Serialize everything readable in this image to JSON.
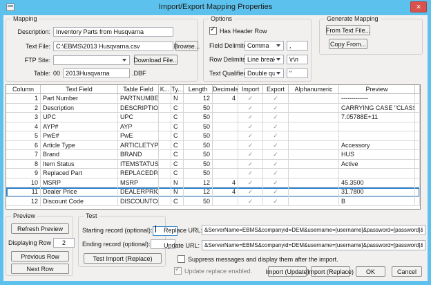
{
  "window": {
    "title": "Import/Export Mapping Properties",
    "close_glyph": "✕"
  },
  "icons": {
    "check": "✓"
  },
  "colors": {
    "titlebar": "#5cc1ec",
    "close_button": "#d9534c",
    "selection": "#3585cc",
    "checkmark": "#8f8f8f"
  },
  "mapping": {
    "group_label": "Mapping",
    "description_label": "Description:",
    "description_value": "Inventory Parts from Husqvarna",
    "text_file_label": "Text File:",
    "text_file_value": "C:\\EBMS\\2013 Husqvarna.csv",
    "browse_button": "Browse...",
    "ftp_site_label": "FTP Site:",
    "ftp_site_value": "",
    "download_file_button": "Download File...",
    "table_label": "Table:",
    "table_prefix": "00",
    "table_value": "2013Husqvarna",
    "table_suffix": ".DBF"
  },
  "options": {
    "group_label": "Options",
    "has_header_row_label": "Has Header Row",
    "has_header_row_checked": true,
    "field_delimiter_label": "Field Delimiter:",
    "field_delimiter_selected": "Comma",
    "field_delimiter_char": ",",
    "row_delimiter_label": "Row Delimiter:",
    "row_delimiter_selected": "Line break",
    "row_delimiter_char": "\\r\\n",
    "text_qualifier_label": "Text Qualifier:",
    "text_qualifier_selected": "Double quote",
    "text_qualifier_char": "\""
  },
  "generate_mapping": {
    "group_label": "Generate Mapping",
    "from_text_file_button": "From Text File...",
    "copy_from_button": "Copy From..."
  },
  "grid": {
    "columns": [
      "Column",
      "Text Field",
      "Table Field",
      "K...",
      "Ty...",
      "Length",
      "Decimals",
      "Import",
      "Export",
      "Alphanumeric",
      "Preview"
    ],
    "selected_row": 11,
    "rows": [
      {
        "column": "1",
        "text_field": "Part Number",
        "table_field": "PARTNUMBER",
        "k": "",
        "ty": "N",
        "length": "12",
        "decimals": "4",
        "import": true,
        "export": true,
        "alphanumeric": "",
        "preview": "-------------"
      },
      {
        "column": "2",
        "text_field": "Description",
        "table_field": "DESCRIPTIO",
        "k": "",
        "ty": "C",
        "length": "50",
        "decimals": "",
        "import": true,
        "export": true,
        "alphanumeric": "",
        "preview": "CARRYING CASE \"CLASSIC\" SINGLE"
      },
      {
        "column": "3",
        "text_field": "UPC",
        "table_field": "UPC",
        "k": "",
        "ty": "C",
        "length": "50",
        "decimals": "",
        "import": true,
        "export": true,
        "alphanumeric": "",
        "preview": "7.05788E+11"
      },
      {
        "column": "4",
        "text_field": "AYP#",
        "table_field": "AYP",
        "k": "",
        "ty": "C",
        "length": "50",
        "decimals": "",
        "import": true,
        "export": true,
        "alphanumeric": "",
        "preview": ""
      },
      {
        "column": "5",
        "text_field": "PwE#",
        "table_field": "PwE",
        "k": "",
        "ty": "C",
        "length": "50",
        "decimals": "",
        "import": true,
        "export": true,
        "alphanumeric": "",
        "preview": ""
      },
      {
        "column": "6",
        "text_field": "Article Type",
        "table_field": "ARTICLETYP",
        "k": "",
        "ty": "C",
        "length": "50",
        "decimals": "",
        "import": true,
        "export": true,
        "alphanumeric": "",
        "preview": "Accessory"
      },
      {
        "column": "7",
        "text_field": "Brand",
        "table_field": "BRAND",
        "k": "",
        "ty": "C",
        "length": "50",
        "decimals": "",
        "import": true,
        "export": true,
        "alphanumeric": "",
        "preview": "HUS"
      },
      {
        "column": "8",
        "text_field": "Item Status",
        "table_field": "ITEMSTATUS",
        "k": "",
        "ty": "C",
        "length": "50",
        "decimals": "",
        "import": true,
        "export": true,
        "alphanumeric": "",
        "preview": "Active"
      },
      {
        "column": "9",
        "text_field": "Replaced Part",
        "table_field": "REPLACEDPA",
        "k": "",
        "ty": "C",
        "length": "50",
        "decimals": "",
        "import": true,
        "export": true,
        "alphanumeric": "",
        "preview": ""
      },
      {
        "column": "10",
        "text_field": "MSRP",
        "table_field": "MSRP",
        "k": "",
        "ty": "N",
        "length": "12",
        "decimals": "4",
        "import": true,
        "export": true,
        "alphanumeric": "",
        "preview": "45.3500"
      },
      {
        "column": "11",
        "text_field": "Dealer Price",
        "table_field": "DEALERPRIC",
        "k": "",
        "ty": "N",
        "length": "12",
        "decimals": "4",
        "import": true,
        "export": true,
        "alphanumeric": "",
        "preview": "31.7800",
        "selected": true
      },
      {
        "column": "12",
        "text_field": "Discount Code",
        "table_field": "DISCOUNTCO",
        "k": "",
        "ty": "C",
        "length": "50",
        "decimals": "",
        "import": true,
        "export": true,
        "alphanumeric": "",
        "preview": "B"
      }
    ]
  },
  "preview_panel": {
    "group_label": "Preview",
    "refresh_button": "Refresh Preview",
    "displaying_row_label": "Displaying Row",
    "displaying_row_value": "2",
    "previous_button": "Previous Row",
    "next_button": "Next Row"
  },
  "test_panel": {
    "group_label": "Test",
    "starting_label": "Starting record (optional):",
    "starting_value": "",
    "ending_label": "Ending record (optional):",
    "ending_value": "",
    "test_button": "Test Import (Replace)"
  },
  "urls": {
    "replace_label": "Replace URL:",
    "replace_value": "&ServerName=EBMS&companyid=DEM&username=[username]&password=[password]&showui=false&C",
    "update_label": "Update URL:",
    "update_value": "&ServerName=EBMS&companyid=DEM&username=[username]&password=[password]&showui=false&C"
  },
  "footer": {
    "suppress_label": "Suppress messages and display them after the import.",
    "suppress_checked": false,
    "update_replace_label": "Update replace enabled.",
    "update_replace_checked": true,
    "import_update_button": "Import (Update)",
    "import_replace_button": "Import (Replace)",
    "ok_button": "OK",
    "cancel_button": "Cancel"
  }
}
